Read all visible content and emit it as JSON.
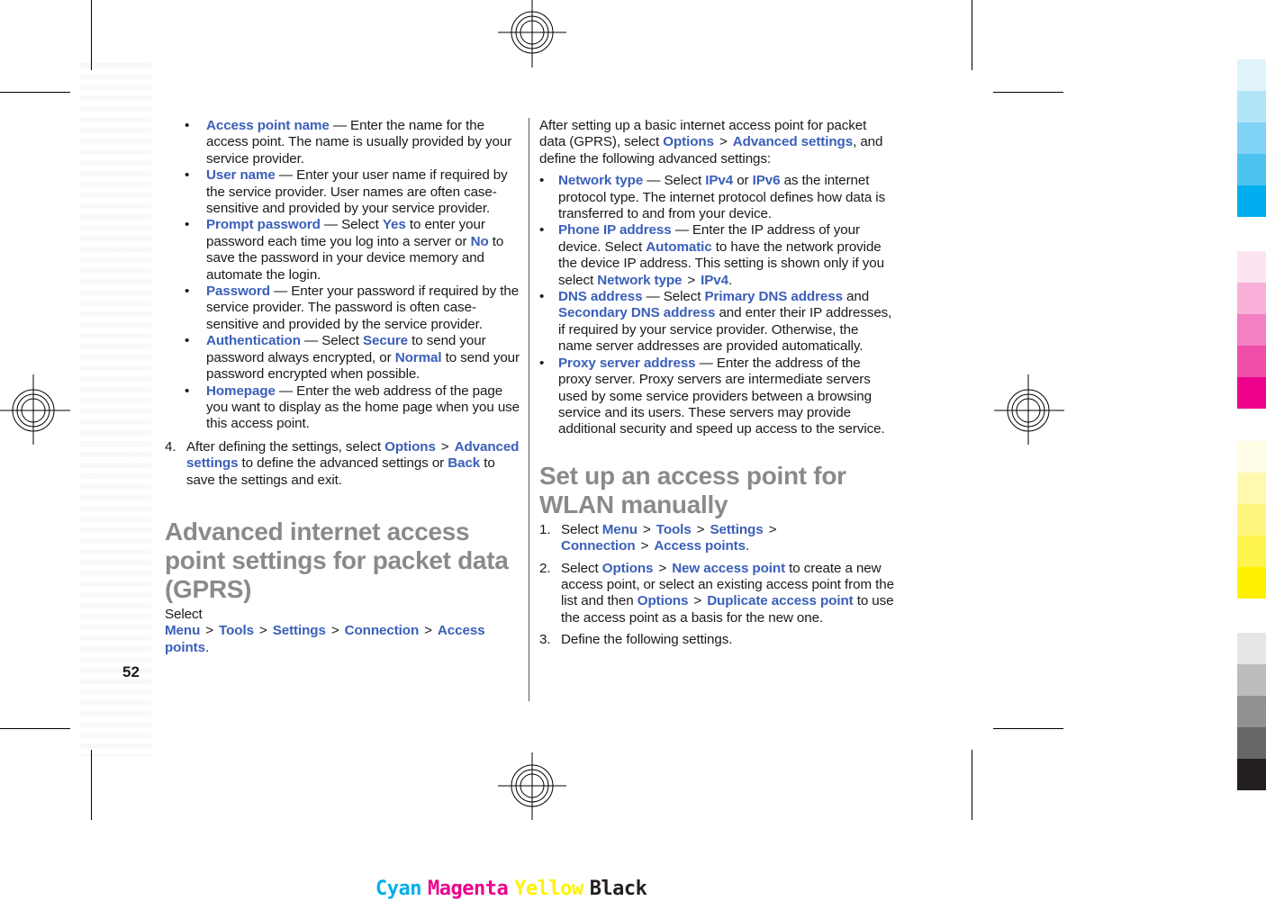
{
  "left_column": {
    "bullets": [
      {
        "term": "Access point name",
        "text": " — Enter the name for the access point. The name is usually provided by your service provider."
      },
      {
        "term": "User name",
        "text": " — Enter your user name if required by the service provider. User names are often case-sensitive and provided by your service provider."
      },
      {
        "term": "Prompt password",
        "text_a": " — Select ",
        "opt_a": "Yes",
        "text_b": " to enter your password each time you log into a server or ",
        "opt_b": "No",
        "text_c": " to save the password in your device memory and automate the login."
      },
      {
        "term": "Password",
        "text": " — Enter your password if required by the service provider. The password is often case-sensitive and provided by the service provider."
      },
      {
        "term": "Authentication",
        "text_a": " — Select ",
        "opt_a": "Secure",
        "text_b": " to send your password always encrypted, or ",
        "opt_b": "Normal",
        "text_c": " to send your password encrypted when possible."
      },
      {
        "term": "Homepage",
        "text": " — Enter the web address of the page you want to display as the home page when you use this access point."
      }
    ],
    "step4": {
      "num": "4.",
      "text_a": "After defining the settings, select ",
      "menu_a": "Options",
      "menu_b": "Advanced settings",
      "text_b": " to define the advanced settings or ",
      "menu_c": "Back",
      "text_c": " to save the settings and exit."
    },
    "heading": "Advanced internet access point settings for packet data (GPRS)",
    "path": {
      "lead": "Select ",
      "items": [
        "Menu",
        "Tools",
        "Settings",
        "Connection",
        "Access points"
      ],
      "trail": "."
    }
  },
  "right_column": {
    "intro": {
      "text_a": "After setting up a basic internet access point for packet data (GPRS), select ",
      "menu_a": "Options",
      "menu_b": "Advanced settings",
      "text_b": ", and define the following advanced settings:"
    },
    "bullets": [
      {
        "term": "Network type",
        "text_a": " — Select ",
        "opt_a": "IPv4",
        "text_b": " or ",
        "opt_b": "IPv6",
        "text_c": " as the internet protocol type. The internet protocol defines how data is transferred to and from your device."
      },
      {
        "term": "Phone IP address",
        "text_a": " — Enter the IP address of your device. Select ",
        "opt_a": "Automatic",
        "text_b": " to have the network provide the device IP address. This setting is shown only if you select ",
        "opt_b": "Network type",
        "opt_c": "IPv4",
        "text_c": "."
      },
      {
        "term": "DNS address",
        "text_a": " — Select ",
        "opt_a": "Primary DNS address",
        "text_b": " and ",
        "opt_b": "Secondary DNS address",
        "text_c": " and enter their IP addresses, if required by your service provider. Otherwise, the name server addresses are provided automatically."
      },
      {
        "term": "Proxy server address",
        "text": " — Enter the address of the proxy server. Proxy servers are intermediate servers used by some service providers between a browsing service and its users. These servers may provide additional security and speed up access to the service."
      }
    ],
    "heading": "Set up an access point for WLAN manually",
    "steps": [
      {
        "num": "1.",
        "lead": "Select ",
        "items": [
          "Menu",
          "Tools",
          "Settings",
          "Connection",
          "Access points"
        ],
        "trail": "."
      },
      {
        "num": "2.",
        "lead": "Select ",
        "menu_a": "Options",
        "menu_b": "New access point",
        "text_a": " to create a new access point, or select an existing access point from the list and then ",
        "menu_c": "Options",
        "menu_d": "Duplicate access point",
        "text_b": " to use the access point as a basis for the new one."
      },
      {
        "num": "3.",
        "text": "Define the following settings."
      }
    ]
  },
  "separator": ">",
  "page_number": "52",
  "print_marks": {
    "color_label": [
      "Cyan",
      "Magenta",
      "Yellow",
      "Black"
    ],
    "color_label_colors": [
      "#00aeef",
      "#ec008c",
      "#fff200",
      "#231f20"
    ],
    "swatches": {
      "cyan": [
        "#e1f4fc",
        "#b3e5f8",
        "#80d3f5",
        "#4dc3f0",
        "#00aeef"
      ],
      "magenta": [
        "#fce4f0",
        "#f8b0d8",
        "#f380c2",
        "#ef4ea8",
        "#ec008c"
      ],
      "yellow": [
        "#fffde5",
        "#fff9b0",
        "#fff680",
        "#fff34d",
        "#fff200"
      ],
      "black": [
        "#e6e6e6",
        "#bcbcbc",
        "#919191",
        "#676767",
        "#231f20"
      ]
    }
  }
}
